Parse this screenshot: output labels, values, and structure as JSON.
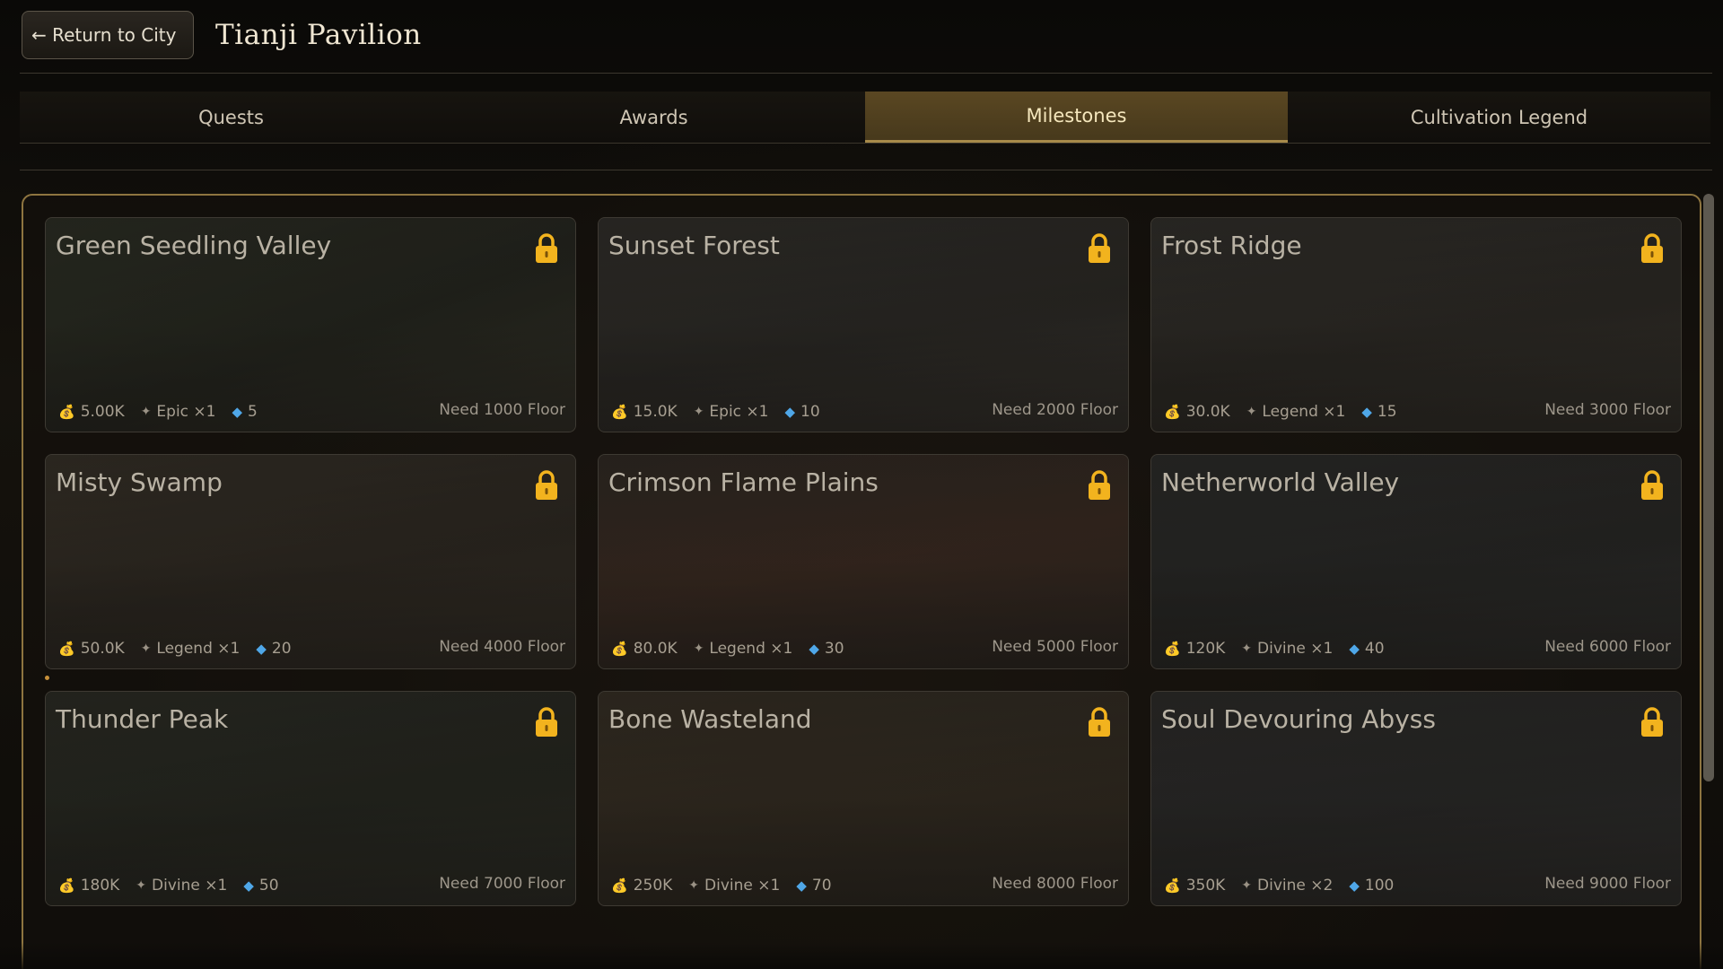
{
  "header": {
    "back_label": "← Return to City",
    "title": "Tianji Pavilion"
  },
  "tabs": [
    {
      "label": "Quests",
      "active": false
    },
    {
      "label": "Awards",
      "active": false
    },
    {
      "label": "Milestones",
      "active": true
    },
    {
      "label": "Cultivation Legend",
      "active": false
    }
  ],
  "icons": {
    "gold": "money-bag-icon",
    "item": "star-icon",
    "gem": "diamond-icon",
    "lock": "lock-icon"
  },
  "colors": {
    "accent_gold": "#a78a4a",
    "lock": "#f2b31e",
    "gem": "#4fa7e8"
  },
  "milestones": [
    {
      "name": "Green Seedling Valley",
      "gold": "5.00K",
      "item": "Epic ×1",
      "gems": "5",
      "requirement": "Need 1000 Floor",
      "locked": true
    },
    {
      "name": "Sunset Forest",
      "gold": "15.0K",
      "item": "Epic ×1",
      "gems": "10",
      "requirement": "Need 2000 Floor",
      "locked": true
    },
    {
      "name": "Frost Ridge",
      "gold": "30.0K",
      "item": "Legend ×1",
      "gems": "15",
      "requirement": "Need 3000 Floor",
      "locked": true
    },
    {
      "name": "Misty Swamp",
      "gold": "50.0K",
      "item": "Legend ×1",
      "gems": "20",
      "requirement": "Need 4000 Floor",
      "locked": true
    },
    {
      "name": "Crimson Flame Plains",
      "gold": "80.0K",
      "item": "Legend ×1",
      "gems": "30",
      "requirement": "Need 5000 Floor",
      "locked": true
    },
    {
      "name": "Netherworld Valley",
      "gold": "120K",
      "item": "Divine ×1",
      "gems": "40",
      "requirement": "Need 6000 Floor",
      "locked": true
    },
    {
      "name": "Thunder Peak",
      "gold": "180K",
      "item": "Divine ×1",
      "gems": "50",
      "requirement": "Need 7000 Floor",
      "locked": true
    },
    {
      "name": "Bone Wasteland",
      "gold": "250K",
      "item": "Divine ×1",
      "gems": "70",
      "requirement": "Need 8000 Floor",
      "locked": true
    },
    {
      "name": "Soul Devouring Abyss",
      "gold": "350K",
      "item": "Divine ×2",
      "gems": "100",
      "requirement": "Need 9000 Floor",
      "locked": true
    }
  ]
}
